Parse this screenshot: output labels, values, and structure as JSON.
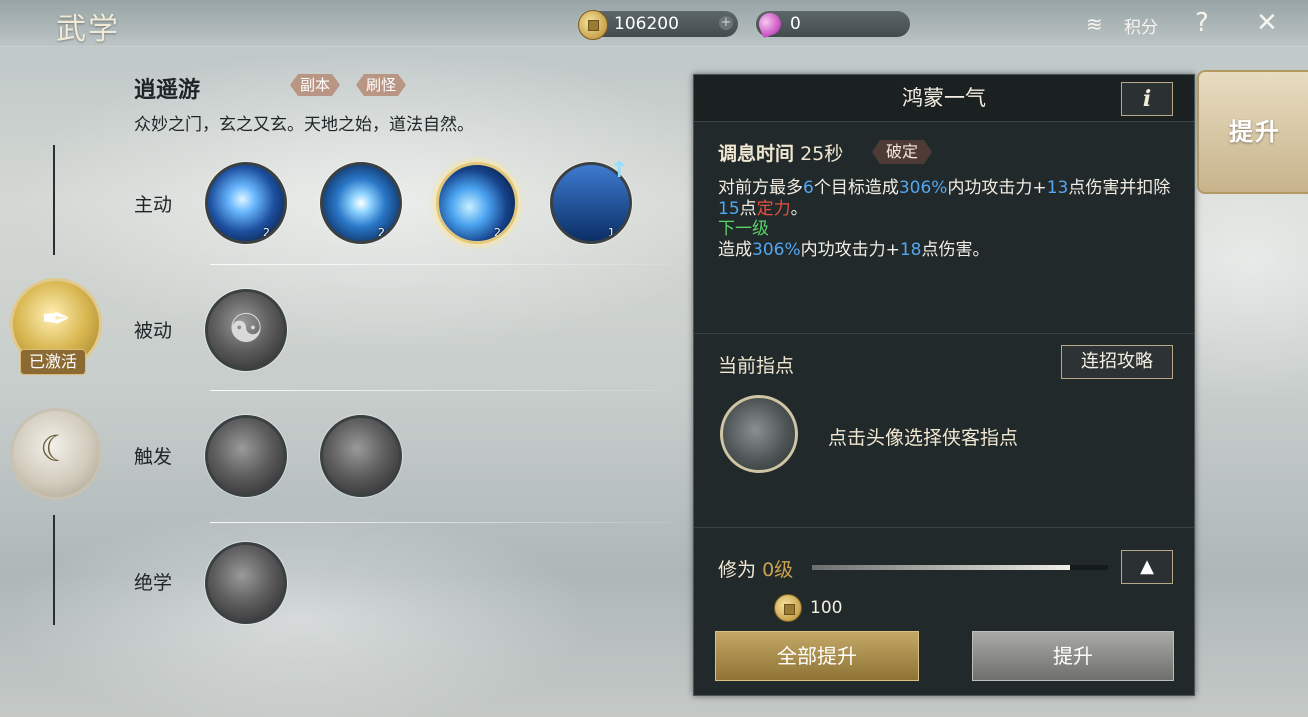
{
  "header": {
    "title": "武学",
    "copper": "106200",
    "gems": "0",
    "points_label": "积分",
    "help_glyph": "?",
    "close_glyph": "✕",
    "plus_glyph": "+"
  },
  "school": {
    "name": "逍遥游",
    "tags": [
      "副本",
      "刷怪"
    ],
    "motto": "众妙之门，玄之又玄。天地之始，道法自然。"
  },
  "categories": [
    {
      "glyph": "✒",
      "badge": "已激活"
    },
    {
      "glyph": "☾"
    }
  ],
  "rows": [
    {
      "label": "主动",
      "levels": [
        "2",
        "2",
        "2",
        "1"
      ]
    },
    {
      "label": "被动"
    },
    {
      "label": "触发"
    },
    {
      "label": "绝学"
    }
  ],
  "panel": {
    "title": "鸿蒙一气",
    "info_glyph": "i",
    "cooldown_label": "调息时间",
    "cooldown_value": "25秒",
    "break_tag": "破定",
    "desc": {
      "p1": "对前方最多",
      "n1": "6",
      "p2": "个目标造成",
      "n2": "306%",
      "p3": "内功攻击力+",
      "n3": "13",
      "p4": "点伤害并扣除",
      "n4": "15",
      "p5": "点",
      "red1": "定力",
      "p6": "。",
      "next_label": "下一级",
      "q1": "造成",
      "m1": "306%",
      "q2": "内功攻击力+",
      "m2": "18",
      "q3": "点伤害。"
    },
    "mentor_label": "当前指点",
    "combo_button": "连招攻略",
    "mentor_hint": "点击头像选择侠客指点",
    "cultivation_label": "修为",
    "cultivation_level": "0级",
    "cultivation_progress": 0.87,
    "up_glyph": "▲",
    "cost": "100",
    "upgrade_all": "全部提升",
    "upgrade": "提升"
  },
  "side_tab": "提升"
}
